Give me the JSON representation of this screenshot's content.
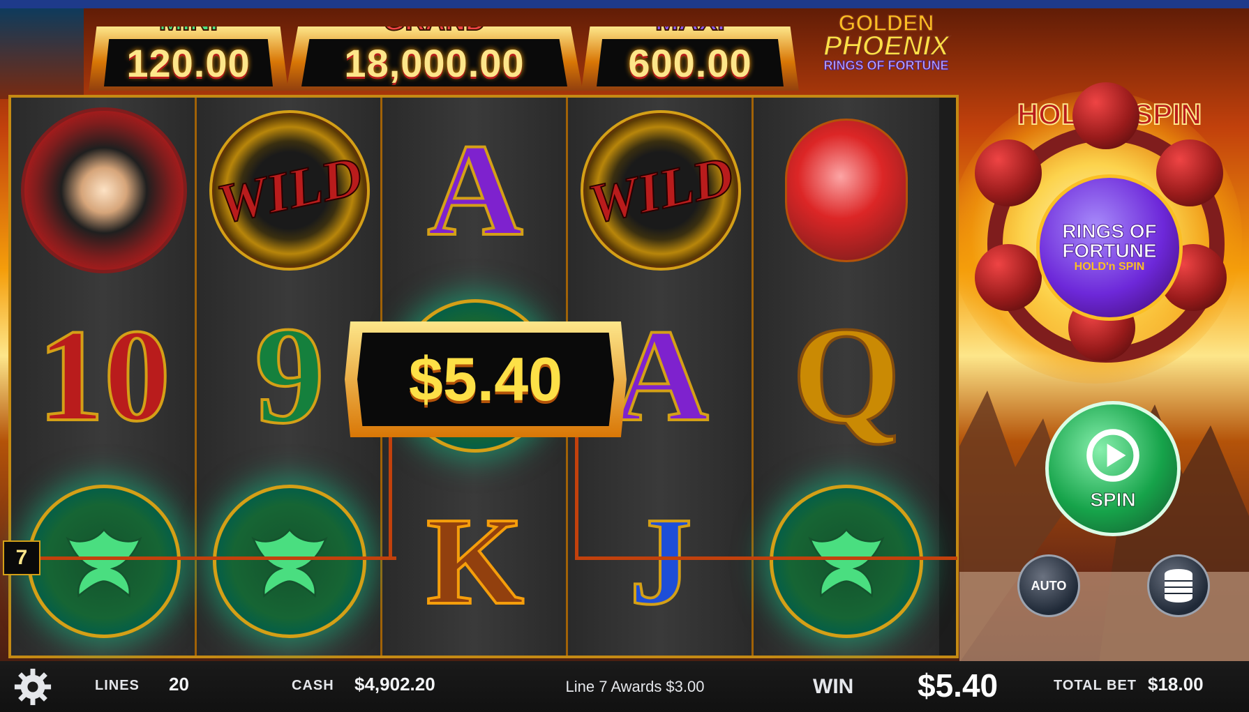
{
  "jackpots": {
    "mini": {
      "label": "MINI",
      "value": "120.00",
      "color": "#4ade80"
    },
    "grand": {
      "label": "GRAND",
      "value": "18,000.00",
      "color": "#ef4444"
    },
    "maxi": {
      "label": "MAXI",
      "value": "600.00",
      "color": "#8b5cf6"
    }
  },
  "logo": {
    "line1": "GOLDEN",
    "line2": "PHOENIX",
    "line3": "RINGS OF FORTUNE"
  },
  "reels": [
    [
      "queen",
      "10",
      "phoenix"
    ],
    [
      "wild",
      "9",
      "phoenix"
    ],
    [
      "A",
      "phoenix",
      "K"
    ],
    [
      "wild",
      "A",
      "J"
    ],
    [
      "lantern",
      "Q",
      "phoenix"
    ]
  ],
  "symbol_text": {
    "wild": "WILD",
    "ten": "10",
    "nine": "9",
    "ace": "A",
    "queen_card": "Q",
    "king": "K",
    "jack": "J"
  },
  "payline": {
    "number": "7"
  },
  "win_popup": {
    "amount": "$5.40"
  },
  "hold_n_spin": {
    "title": "HOLD'n SPIN",
    "core_l1": "RINGS OF",
    "core_l2": "FORTUNE",
    "core_l3": "HOLD'n SPIN"
  },
  "controls": {
    "spin_label": "SPIN",
    "auto_label": "AUTO",
    "spin_icon": "play-icon",
    "stake_icon": "coin-stack-icon",
    "settings_icon": "gear-icon"
  },
  "bottom_bar": {
    "lines_label": "LINES",
    "lines_value": "20",
    "cash_label": "CASH",
    "cash_value": "$4,902.20",
    "message": "Line 7 Awards $3.00",
    "win_label": "WIN",
    "win_value": "$5.40",
    "total_bet_label": "TOTAL BET",
    "total_bet_value": "$18.00"
  }
}
